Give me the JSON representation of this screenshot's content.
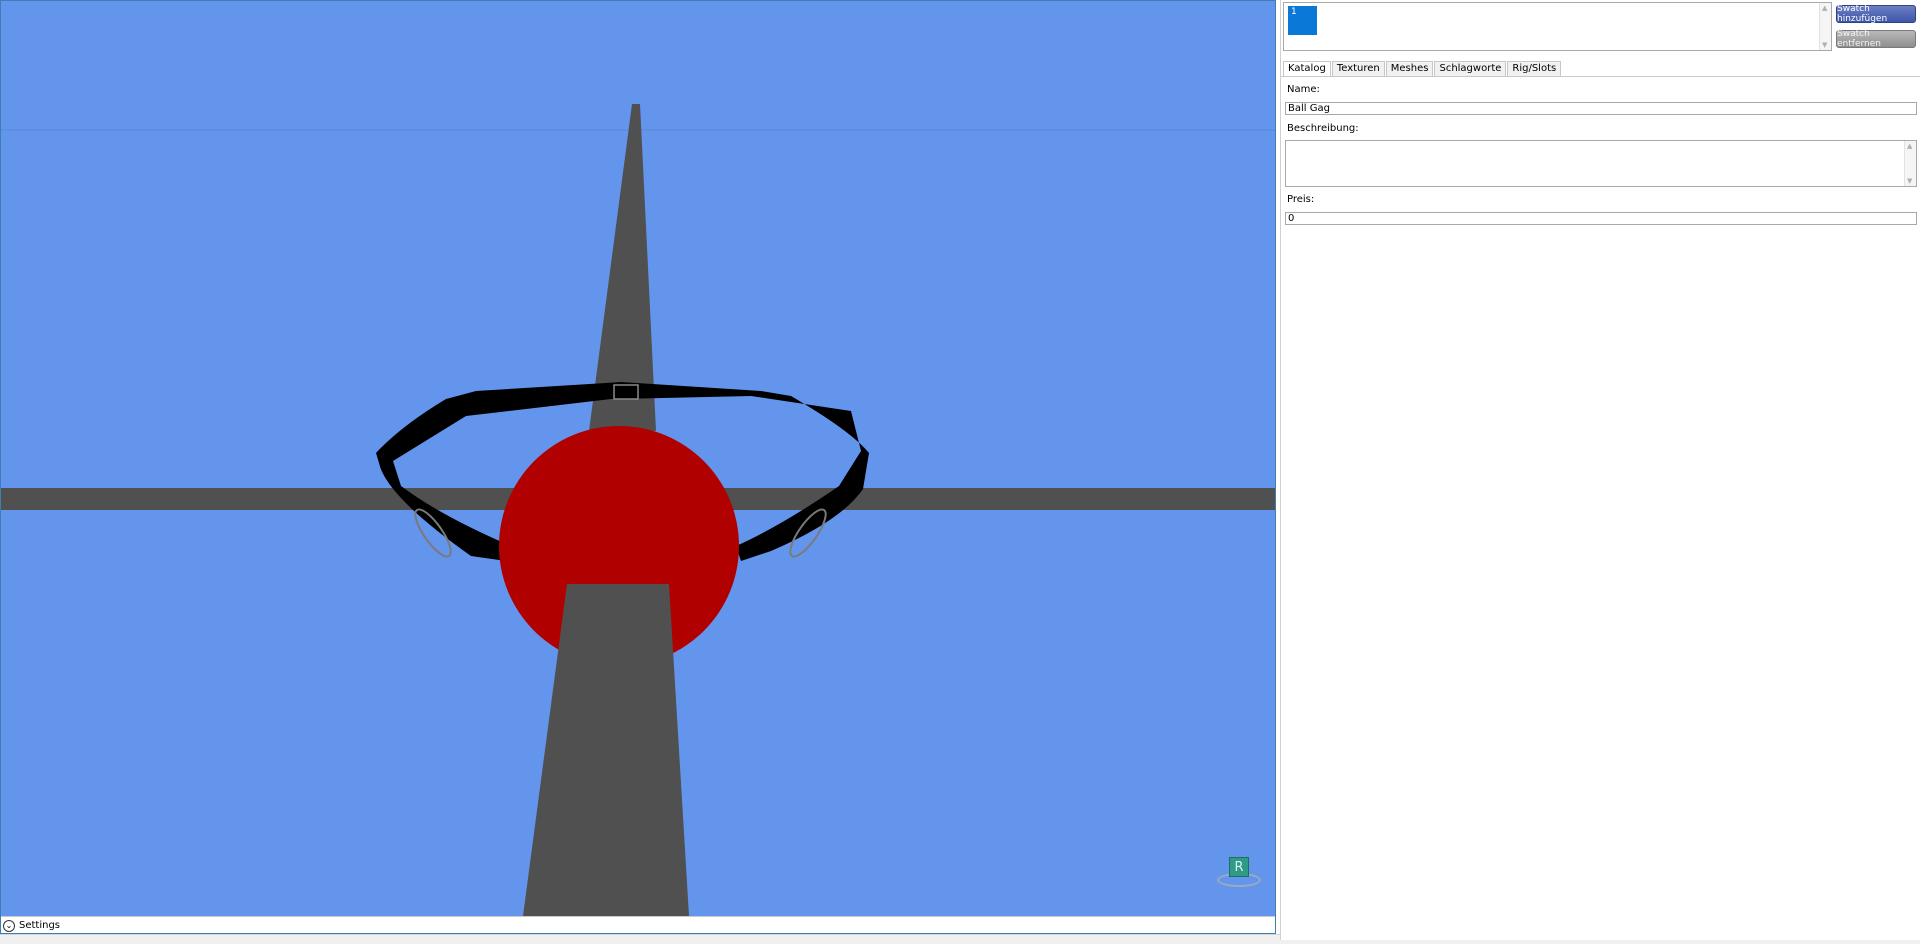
{
  "viewport": {
    "background_color": "#6495ed",
    "ball_color": "#b00000",
    "strap_color": "#000000",
    "bone_color": "#505050",
    "gizmo_label": "R",
    "settings_label": "Settings",
    "settings_icon": "chevron-down-icon"
  },
  "swatches": {
    "items": [
      {
        "label": "1",
        "color": "#0a78d7"
      }
    ],
    "add_label": "Swatch hinzufügen",
    "remove_label": "Swatch entfernen"
  },
  "tabs": [
    {
      "label": "Katalog",
      "active": true
    },
    {
      "label": "Texturen",
      "active": false
    },
    {
      "label": "Meshes",
      "active": false
    },
    {
      "label": "Schlagworte",
      "active": false
    },
    {
      "label": "Rig/Slots",
      "active": false
    }
  ],
  "form": {
    "name_label": "Name:",
    "name_value": "Ball Gag",
    "description_label": "Beschreibung:",
    "description_value": "",
    "price_label": "Preis:",
    "price_value": "0"
  }
}
